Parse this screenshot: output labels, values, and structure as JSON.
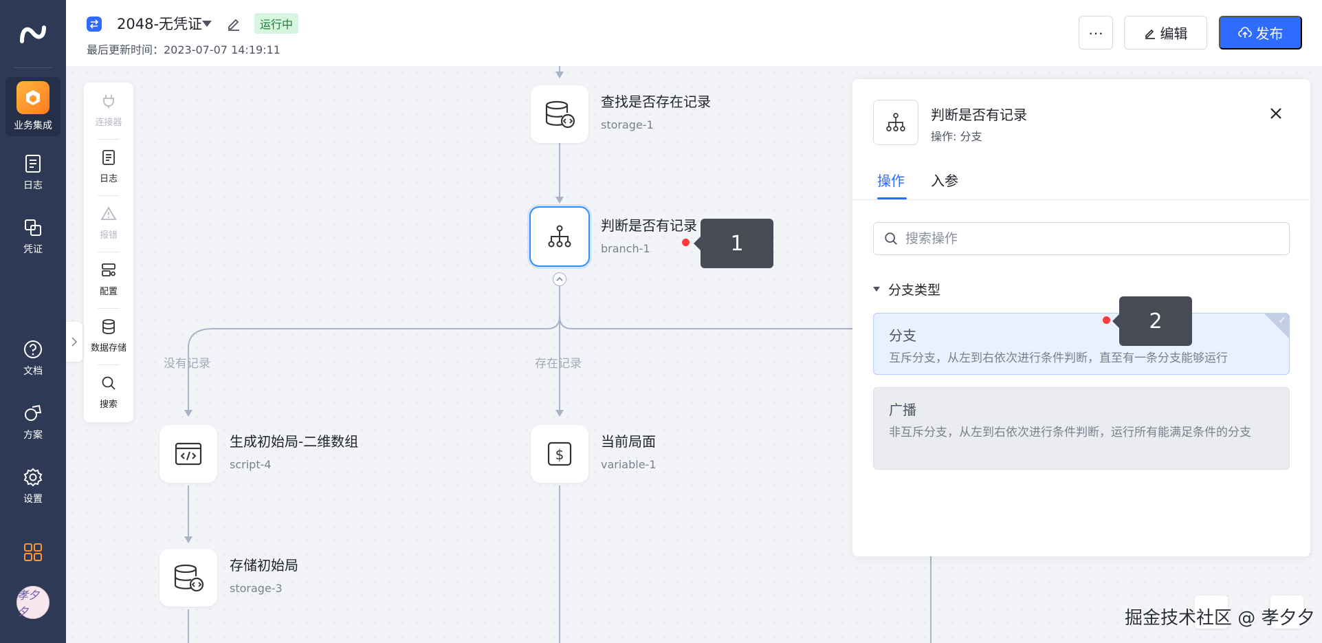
{
  "colors": {
    "accent": "#2f6bff",
    "nav_bg": "#2e3a55",
    "selected_node": "#2f8cff",
    "status_bg": "#d8f5df",
    "marker": "#ff3b3b"
  },
  "nav": {
    "items": [
      {
        "label": "业务集成",
        "icon": "cube-icon"
      },
      {
        "label": "日志",
        "icon": "log-icon"
      },
      {
        "label": "凭证",
        "icon": "credential-icon"
      },
      {
        "label": "文档",
        "icon": "help-icon"
      },
      {
        "label": "方案",
        "icon": "solution-icon"
      },
      {
        "label": "设置",
        "icon": "gear-icon"
      }
    ],
    "avatar_text": "孝夕夕"
  },
  "header": {
    "flow_name": "2048-无凭证",
    "status": "运行中",
    "updated": "最后更新时间：2023-07-07 14:19:11",
    "more_label": "···",
    "edit_label": "编辑",
    "publish_label": "发布"
  },
  "tools": [
    {
      "label": "连接器",
      "icon": "plug-icon",
      "disabled": true
    },
    {
      "label": "日志",
      "icon": "log-icon",
      "disabled": false
    },
    {
      "label": "报错",
      "icon": "warning-icon",
      "disabled": true
    },
    {
      "label": "配置",
      "icon": "config-icon",
      "disabled": false
    },
    {
      "label": "数据存储",
      "icon": "database-icon",
      "disabled": false
    },
    {
      "label": "搜索",
      "icon": "search-icon",
      "disabled": false
    }
  ],
  "nodes": {
    "storage1": {
      "name": "查找是否存在记录",
      "id": "storage-1"
    },
    "branch1": {
      "name": "判断是否有记录",
      "id": "branch-1"
    },
    "script4": {
      "name": "生成初始局-二维数组",
      "id": "script-4"
    },
    "variable1": {
      "name": "当前局面",
      "id": "variable-1"
    },
    "storage3": {
      "name": "存储初始局",
      "id": "storage-3"
    }
  },
  "edges": {
    "no_record": "没有记录",
    "has_record": "存在记录"
  },
  "panel": {
    "title": "判断是否有记录",
    "subtitle": "操作: 分支",
    "tabs": [
      "操作",
      "入参"
    ],
    "search_placeholder": "搜索操作",
    "section_title": "分支类型",
    "options": [
      {
        "title": "分支",
        "desc": "互斥分支，从左到右依次进行条件判断，直至有一条分支能够运行"
      },
      {
        "title": "广播",
        "desc": "非互斥分支，从左到右依次进行条件判断，运行所有能满足条件的分支"
      }
    ]
  },
  "markers": [
    "1",
    "2"
  ],
  "watermark": "掘金技术社区 @ 孝夕夕"
}
